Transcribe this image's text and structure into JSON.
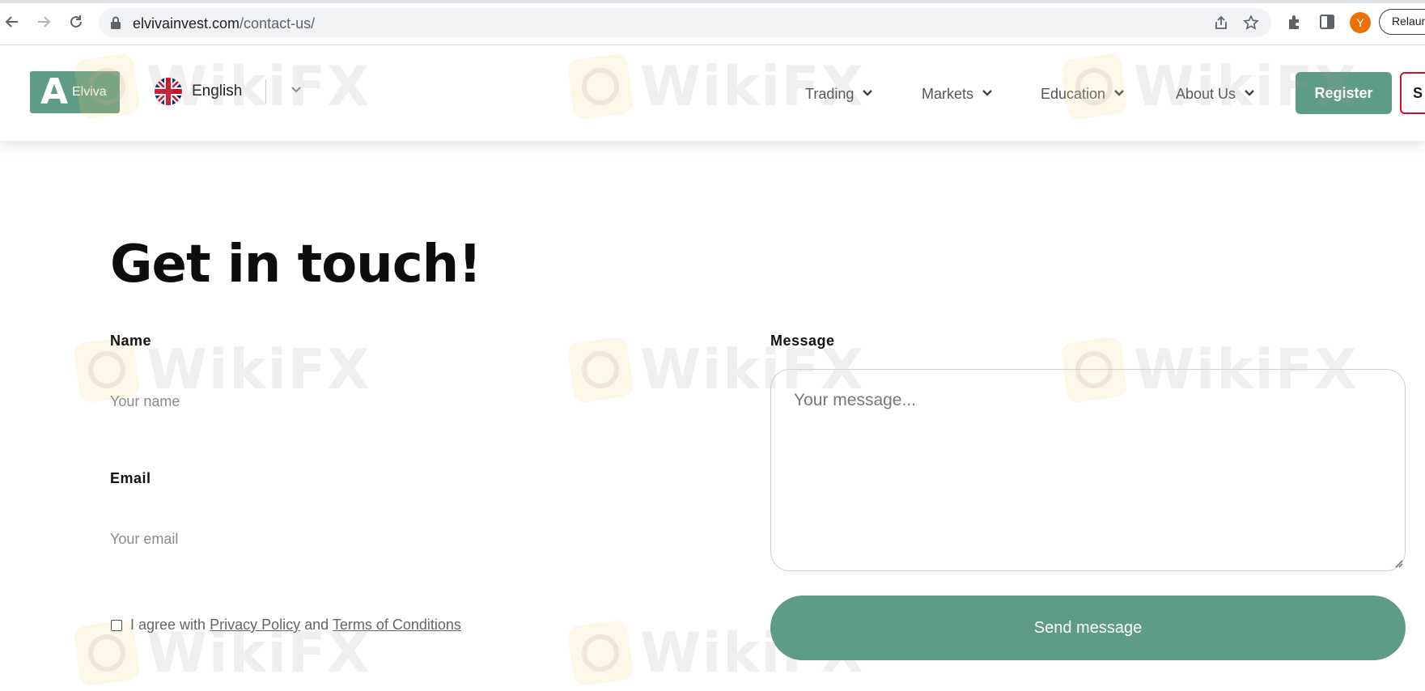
{
  "browser": {
    "url_domain": "elvivainvest.com",
    "url_path": "/contact-us/",
    "profile_initial": "Y",
    "relaunch_label": "Relaunch"
  },
  "header": {
    "logo_mark": "A",
    "logo_text": "Elviva",
    "language": "English",
    "menu": [
      {
        "label": "Trading"
      },
      {
        "label": "Markets"
      },
      {
        "label": "Education"
      },
      {
        "label": "About Us"
      }
    ],
    "register_label": "Register",
    "signin_label": "S"
  },
  "watermark_text": "WikiFX",
  "contact": {
    "title": "Get in touch!",
    "name_label": "Name",
    "name_placeholder": "Your name",
    "email_label": "Email",
    "email_placeholder": "Your email",
    "message_label": "Message",
    "message_placeholder": "Your message...",
    "agree_prefix": "I agree with",
    "privacy_link": "Privacy Policy",
    "agree_and": "and",
    "terms_link": "Terms of Conditions",
    "send_label": "Send message"
  },
  "colors": {
    "brand_green": "#5e9c86",
    "signin_border": "#d0112b",
    "avatar": "#e8710a"
  }
}
